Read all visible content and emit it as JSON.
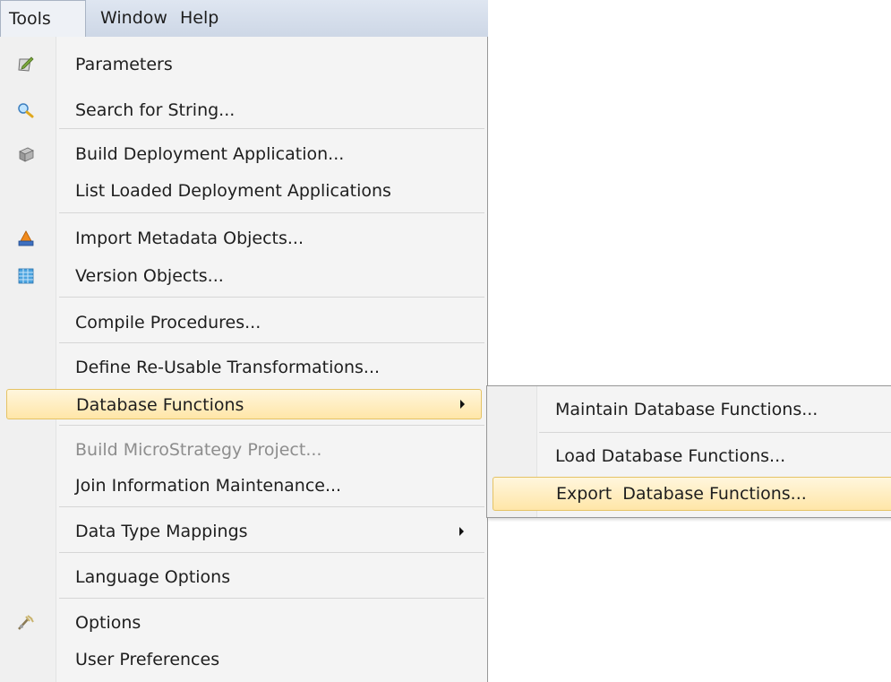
{
  "menubar": {
    "items": [
      {
        "label": "Tools"
      },
      {
        "label": "Window"
      },
      {
        "label": "Help"
      }
    ]
  },
  "tools_menu": {
    "items": [
      {
        "label": "Parameters",
        "icon": "parameters-icon"
      },
      {
        "label": "Search for String...",
        "icon": "search-icon"
      },
      {
        "label": "Build Deployment Application...",
        "icon": "deployment-icon"
      },
      {
        "label": "List Loaded Deployment Applications"
      },
      {
        "label": "Import Metadata Objects...",
        "icon": "import-icon"
      },
      {
        "label": "Version Objects...",
        "icon": "version-icon"
      },
      {
        "label": "Compile Procedures..."
      },
      {
        "label": "Define Re-Usable Transformations..."
      },
      {
        "label": "Database Functions",
        "submenu": true,
        "highlighted": true
      },
      {
        "label": "Build MicroStrategy Project...",
        "disabled": true
      },
      {
        "label": "Join Information Maintenance..."
      },
      {
        "label": "Data Type Mappings",
        "submenu": true
      },
      {
        "label": "Language Options"
      },
      {
        "label": "Options",
        "icon": "options-icon"
      },
      {
        "label": "User Preferences"
      }
    ]
  },
  "database_functions_submenu": {
    "items": [
      {
        "label": "Maintain Database Functions..."
      },
      {
        "label": "Load Database Functions..."
      },
      {
        "label": "Export  Database Functions...",
        "highlighted": true
      }
    ]
  },
  "colors": {
    "highlight_top": "#fff6dd",
    "highlight_bottom": "#ffe6a8",
    "highlight_border": "#e5c365",
    "menubar": "#d5dde9",
    "disabled_text": "#8d8d8d"
  }
}
